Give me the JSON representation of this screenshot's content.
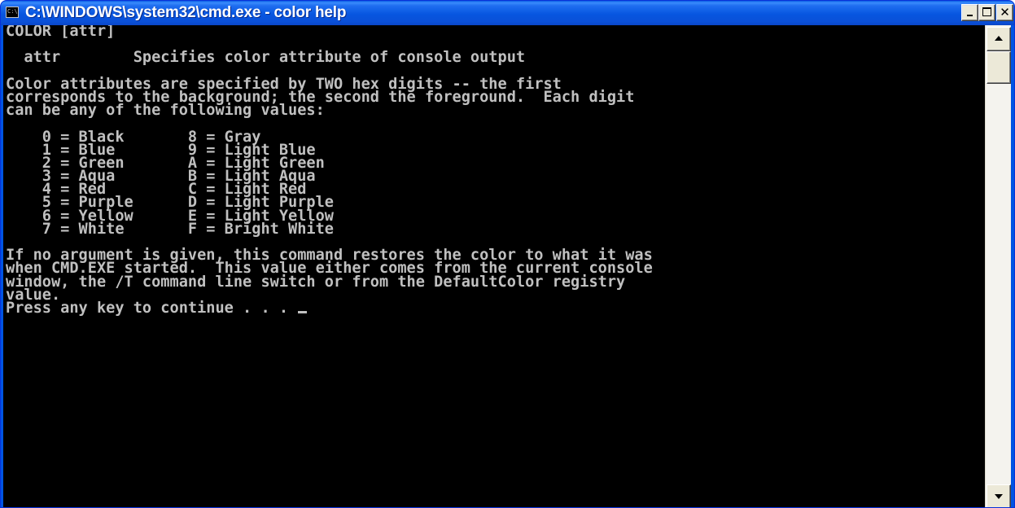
{
  "window": {
    "title": "C:\\WINDOWS\\system32\\cmd.exe - color help",
    "icon": "cmd-icon",
    "icon_text": "C:\\",
    "buttons": {
      "minimize": "minimize-icon",
      "maximize": "maximize-icon",
      "close_glyph": "✕"
    }
  },
  "console": {
    "lines": [
      "COLOR [attr]",
      "",
      "  attr        Specifies color attribute of console output",
      "",
      "Color attributes are specified by TWO hex digits -- the first",
      "corresponds to the background; the second the foreground.  Each digit",
      "can be any of the following values:",
      "",
      "    0 = Black       8 = Gray",
      "    1 = Blue        9 = Light Blue",
      "    2 = Green       A = Light Green",
      "    3 = Aqua        B = Light Aqua",
      "    4 = Red         C = Light Red",
      "    5 = Purple      D = Light Purple",
      "    6 = Yellow      E = Light Yellow",
      "    7 = White       F = Bright White",
      "",
      "If no argument is given, this command restores the color to what it was",
      "when CMD.EXE started.  This value either comes from the current console",
      "window, the /T command line switch or from the DefaultColor registry",
      "value."
    ],
    "prompt": "Press any key to continue . . . "
  },
  "colors": {
    "console_bg": "#000000",
    "console_fg": "#c0c0c0",
    "titlebar": "#0054e3"
  }
}
